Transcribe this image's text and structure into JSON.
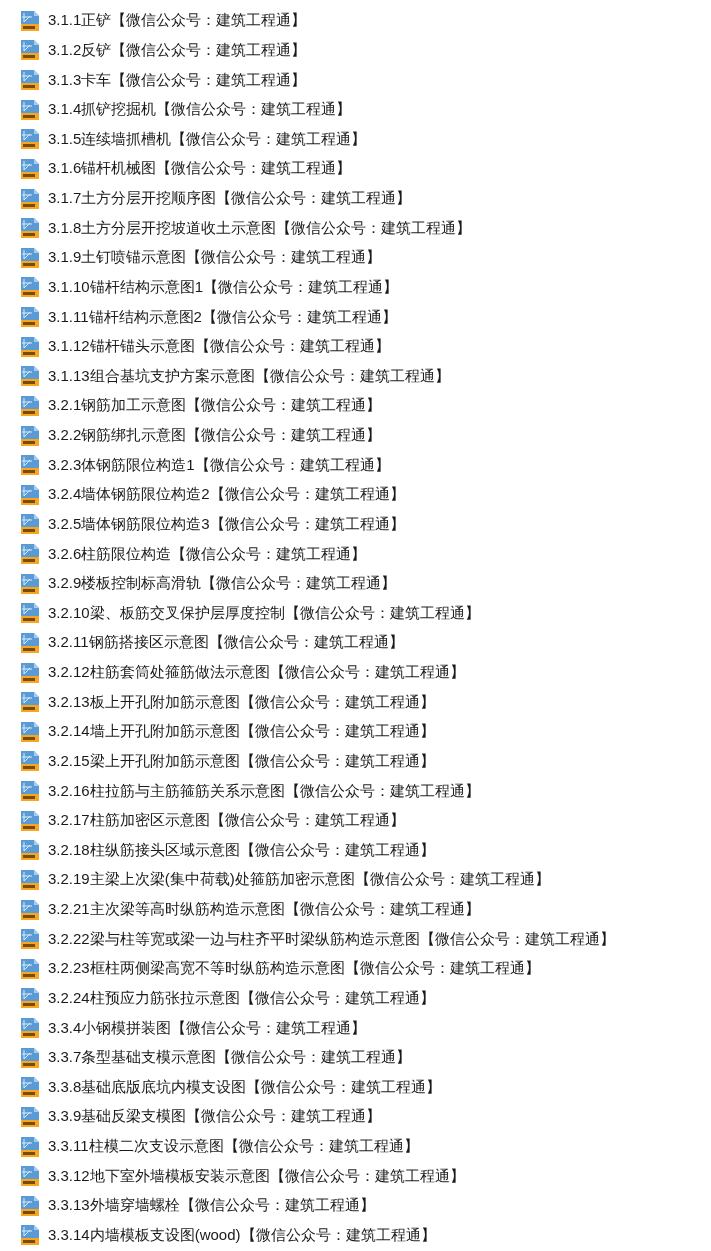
{
  "files": [
    {
      "name": "3.1.1正铲【微信公众号：建筑工程通】"
    },
    {
      "name": "3.1.2反铲【微信公众号：建筑工程通】"
    },
    {
      "name": "3.1.3卡车【微信公众号：建筑工程通】"
    },
    {
      "name": "3.1.4抓铲挖掘机【微信公众号：建筑工程通】"
    },
    {
      "name": "3.1.5连续墙抓槽机【微信公众号：建筑工程通】"
    },
    {
      "name": "3.1.6锚杆机械图【微信公众号：建筑工程通】"
    },
    {
      "name": "3.1.7土方分层开挖顺序图【微信公众号：建筑工程通】"
    },
    {
      "name": "3.1.8土方分层开挖坡道收土示意图【微信公众号：建筑工程通】"
    },
    {
      "name": "3.1.9土钉喷锚示意图【微信公众号：建筑工程通】"
    },
    {
      "name": "3.1.10锚杆结构示意图1【微信公众号：建筑工程通】"
    },
    {
      "name": "3.1.11锚杆结构示意图2【微信公众号：建筑工程通】"
    },
    {
      "name": "3.1.12锚杆锚头示意图【微信公众号：建筑工程通】"
    },
    {
      "name": "3.1.13组合基坑支护方案示意图【微信公众号：建筑工程通】"
    },
    {
      "name": "3.2.1钢筋加工示意图【微信公众号：建筑工程通】"
    },
    {
      "name": "3.2.2钢筋绑扎示意图【微信公众号：建筑工程通】"
    },
    {
      "name": "3.2.3体钢筋限位构造1【微信公众号：建筑工程通】"
    },
    {
      "name": "3.2.4墙体钢筋限位构造2【微信公众号：建筑工程通】"
    },
    {
      "name": "3.2.5墙体钢筋限位构造3【微信公众号：建筑工程通】"
    },
    {
      "name": "3.2.6柱筋限位构造【微信公众号：建筑工程通】"
    },
    {
      "name": "3.2.9楼板控制标高滑轨【微信公众号：建筑工程通】"
    },
    {
      "name": "3.2.10梁、板筋交叉保护层厚度控制【微信公众号：建筑工程通】"
    },
    {
      "name": "3.2.11钢筋搭接区示意图【微信公众号：建筑工程通】"
    },
    {
      "name": "3.2.12柱筋套筒处箍筋做法示意图【微信公众号：建筑工程通】"
    },
    {
      "name": "3.2.13板上开孔附加筋示意图【微信公众号：建筑工程通】"
    },
    {
      "name": "3.2.14墙上开孔附加筋示意图【微信公众号：建筑工程通】"
    },
    {
      "name": "3.2.15梁上开孔附加筋示意图【微信公众号：建筑工程通】"
    },
    {
      "name": "3.2.16柱拉筋与主筋箍筋关系示意图【微信公众号：建筑工程通】"
    },
    {
      "name": "3.2.17柱筋加密区示意图【微信公众号：建筑工程通】"
    },
    {
      "name": "3.2.18柱纵筋接头区域示意图【微信公众号：建筑工程通】"
    },
    {
      "name": "3.2.19主梁上次梁(集中荷载)处箍筋加密示意图【微信公众号：建筑工程通】"
    },
    {
      "name": "3.2.21主次梁等高时纵筋构造示意图【微信公众号：建筑工程通】"
    },
    {
      "name": "3.2.22梁与柱等宽或梁一边与柱齐平时梁纵筋构造示意图【微信公众号：建筑工程通】"
    },
    {
      "name": "3.2.23框柱两侧梁高宽不等时纵筋构造示意图【微信公众号：建筑工程通】"
    },
    {
      "name": "3.2.24柱预应力筋张拉示意图【微信公众号：建筑工程通】"
    },
    {
      "name": "3.3.4小钢模拼装图【微信公众号：建筑工程通】"
    },
    {
      "name": "3.3.7条型基础支模示意图【微信公众号：建筑工程通】"
    },
    {
      "name": "3.3.8基础底版底坑内模支设图【微信公众号：建筑工程通】"
    },
    {
      "name": "3.3.9基础反梁支模图【微信公众号：建筑工程通】"
    },
    {
      "name": "3.3.11柱模二次支设示意图【微信公众号：建筑工程通】"
    },
    {
      "name": "3.3.12地下室外墙模板安装示意图【微信公众号：建筑工程通】"
    },
    {
      "name": "3.3.13外墙穿墙螺栓【微信公众号：建筑工程通】"
    },
    {
      "name": "3.3.14内墙模板支设图(wood)【微信公众号：建筑工程通】"
    }
  ]
}
